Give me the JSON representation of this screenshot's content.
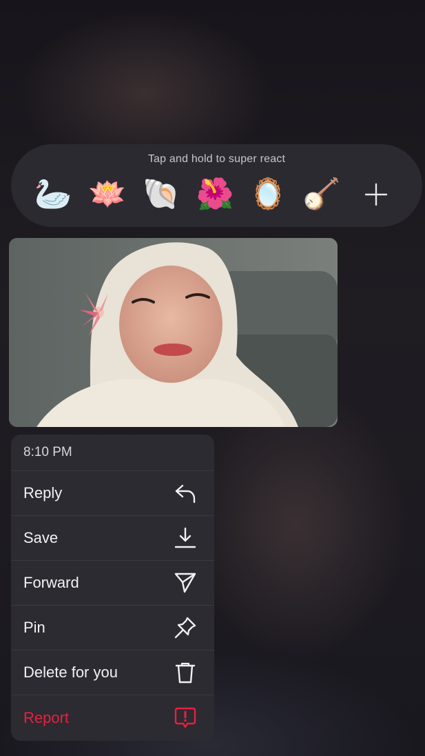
{
  "reactions": {
    "hint": "Tap and hold to super react",
    "emojis": [
      {
        "name": "swan",
        "glyph": "🦢"
      },
      {
        "name": "lotus",
        "glyph": "🪷"
      },
      {
        "name": "spiral-shell",
        "glyph": "🐚"
      },
      {
        "name": "hibiscus",
        "glyph": "🌺"
      },
      {
        "name": "mirror",
        "glyph": "🪞"
      },
      {
        "name": "banjo",
        "glyph": "🪕"
      }
    ],
    "more_icon": "plus-icon"
  },
  "message": {
    "image_alt": "Photo message: person in white hijab with a pink flower, smiling"
  },
  "menu": {
    "timestamp": "8:10 PM",
    "items": [
      {
        "label": "Reply",
        "icon": "reply-icon"
      },
      {
        "label": "Save",
        "icon": "download-icon"
      },
      {
        "label": "Forward",
        "icon": "send-icon"
      },
      {
        "label": "Pin",
        "icon": "pin-icon"
      },
      {
        "label": "Delete for you",
        "icon": "trash-icon"
      },
      {
        "label": "Report",
        "icon": "report-icon"
      }
    ],
    "danger_color": "#e8203f"
  }
}
